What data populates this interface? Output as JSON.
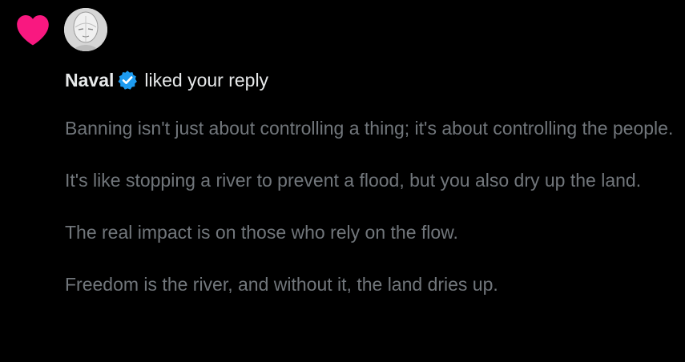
{
  "notification": {
    "type_icon": "heart-icon",
    "heart_color": "#f91880",
    "avatar": "avatar-image",
    "user_name": "Naval",
    "verified_icon": "verified-badge-icon",
    "verified_color": "#1d9bf0",
    "action_text": "liked your reply",
    "reply_paragraphs": [
      "Banning isn't just about controlling a thing; it's about controlling the people.",
      "It's like stopping a river to prevent a flood, but you also dry up the land.",
      "The real impact is on those who rely on the flow.",
      "Freedom is the river, and without it, the land dries up."
    ]
  }
}
